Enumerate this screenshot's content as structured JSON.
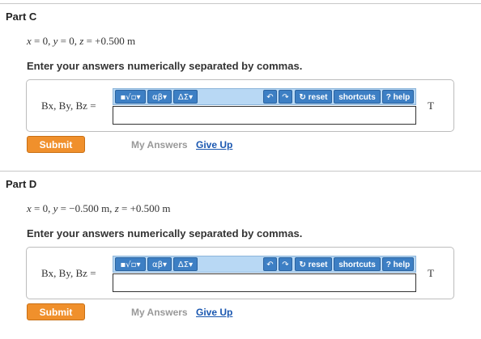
{
  "parts": [
    {
      "title": "Part C",
      "condition": {
        "x_label": "x",
        "x_val": " = 0,  ",
        "y_label": "y",
        "y_val": " = 0,  ",
        "z_label": "z",
        "z_val": " = +0.500 m"
      },
      "prompt": "Enter your answers numerically separated by commas.",
      "answer_label": "Bx, By, Bz =",
      "unit": "T",
      "input_value": "",
      "toolbar": {
        "template": "▪√▫▾",
        "greek": "αβ▾",
        "symbols": "ΔΣ▾",
        "undo": "↶",
        "redo": "↷",
        "reset": "↻ reset",
        "shortcuts": "shortcuts",
        "help": "? help"
      },
      "submit_label": "Submit",
      "my_answers_label": "My Answers",
      "give_up_label": "Give Up"
    },
    {
      "title": "Part D",
      "condition": {
        "x_label": "x",
        "x_val": " = 0,  ",
        "y_label": "y",
        "y_val": " = −0.500 m,  ",
        "z_label": "z",
        "z_val": " = +0.500 m"
      },
      "prompt": "Enter your answers numerically separated by commas.",
      "answer_label": "Bx, By, Bz =",
      "unit": "T",
      "input_value": "",
      "toolbar": {
        "template": "▪√▫▾",
        "greek": "αβ▾",
        "symbols": "ΔΣ▾",
        "undo": "↶",
        "redo": "↷",
        "reset": "↻ reset",
        "shortcuts": "shortcuts",
        "help": "? help"
      },
      "submit_label": "Submit",
      "my_answers_label": "My Answers",
      "give_up_label": "Give Up"
    }
  ]
}
